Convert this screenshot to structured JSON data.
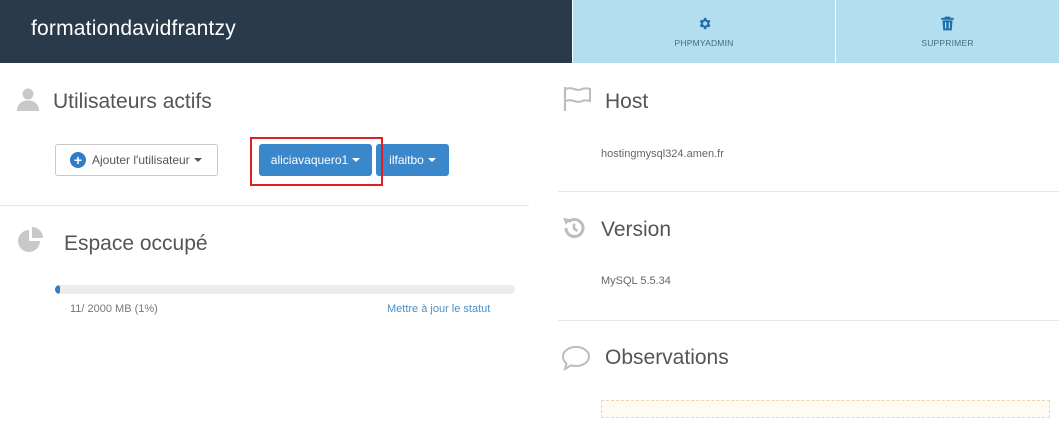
{
  "header": {
    "brand": "formationdavidfrantzy",
    "phpmyadmin_label": "PHPMYADMIN",
    "delete_label": "SUPPRIMER"
  },
  "users": {
    "title": "Utilisateurs actifs",
    "add_button": "Ajouter l'utilisateur",
    "items": [
      {
        "label": "aliciavaquero1"
      },
      {
        "label": "ilfaitbo"
      }
    ]
  },
  "space": {
    "title": "Espace occupé",
    "usage_text": "11/ 2000 MB (1%)",
    "usage_fraction": 0.01,
    "update_link": "Mettre à jour le statut"
  },
  "host": {
    "title": "Host",
    "value": "hostingmysql324.amen.fr"
  },
  "version": {
    "title": "Version",
    "value": "MySQL 5.5.34"
  },
  "observations": {
    "title": "Observations"
  },
  "colors": {
    "header_bg": "#2b3a4a",
    "header_button_bg": "#b3def0",
    "primary": "#3a87cc",
    "highlight": "#e02020"
  }
}
